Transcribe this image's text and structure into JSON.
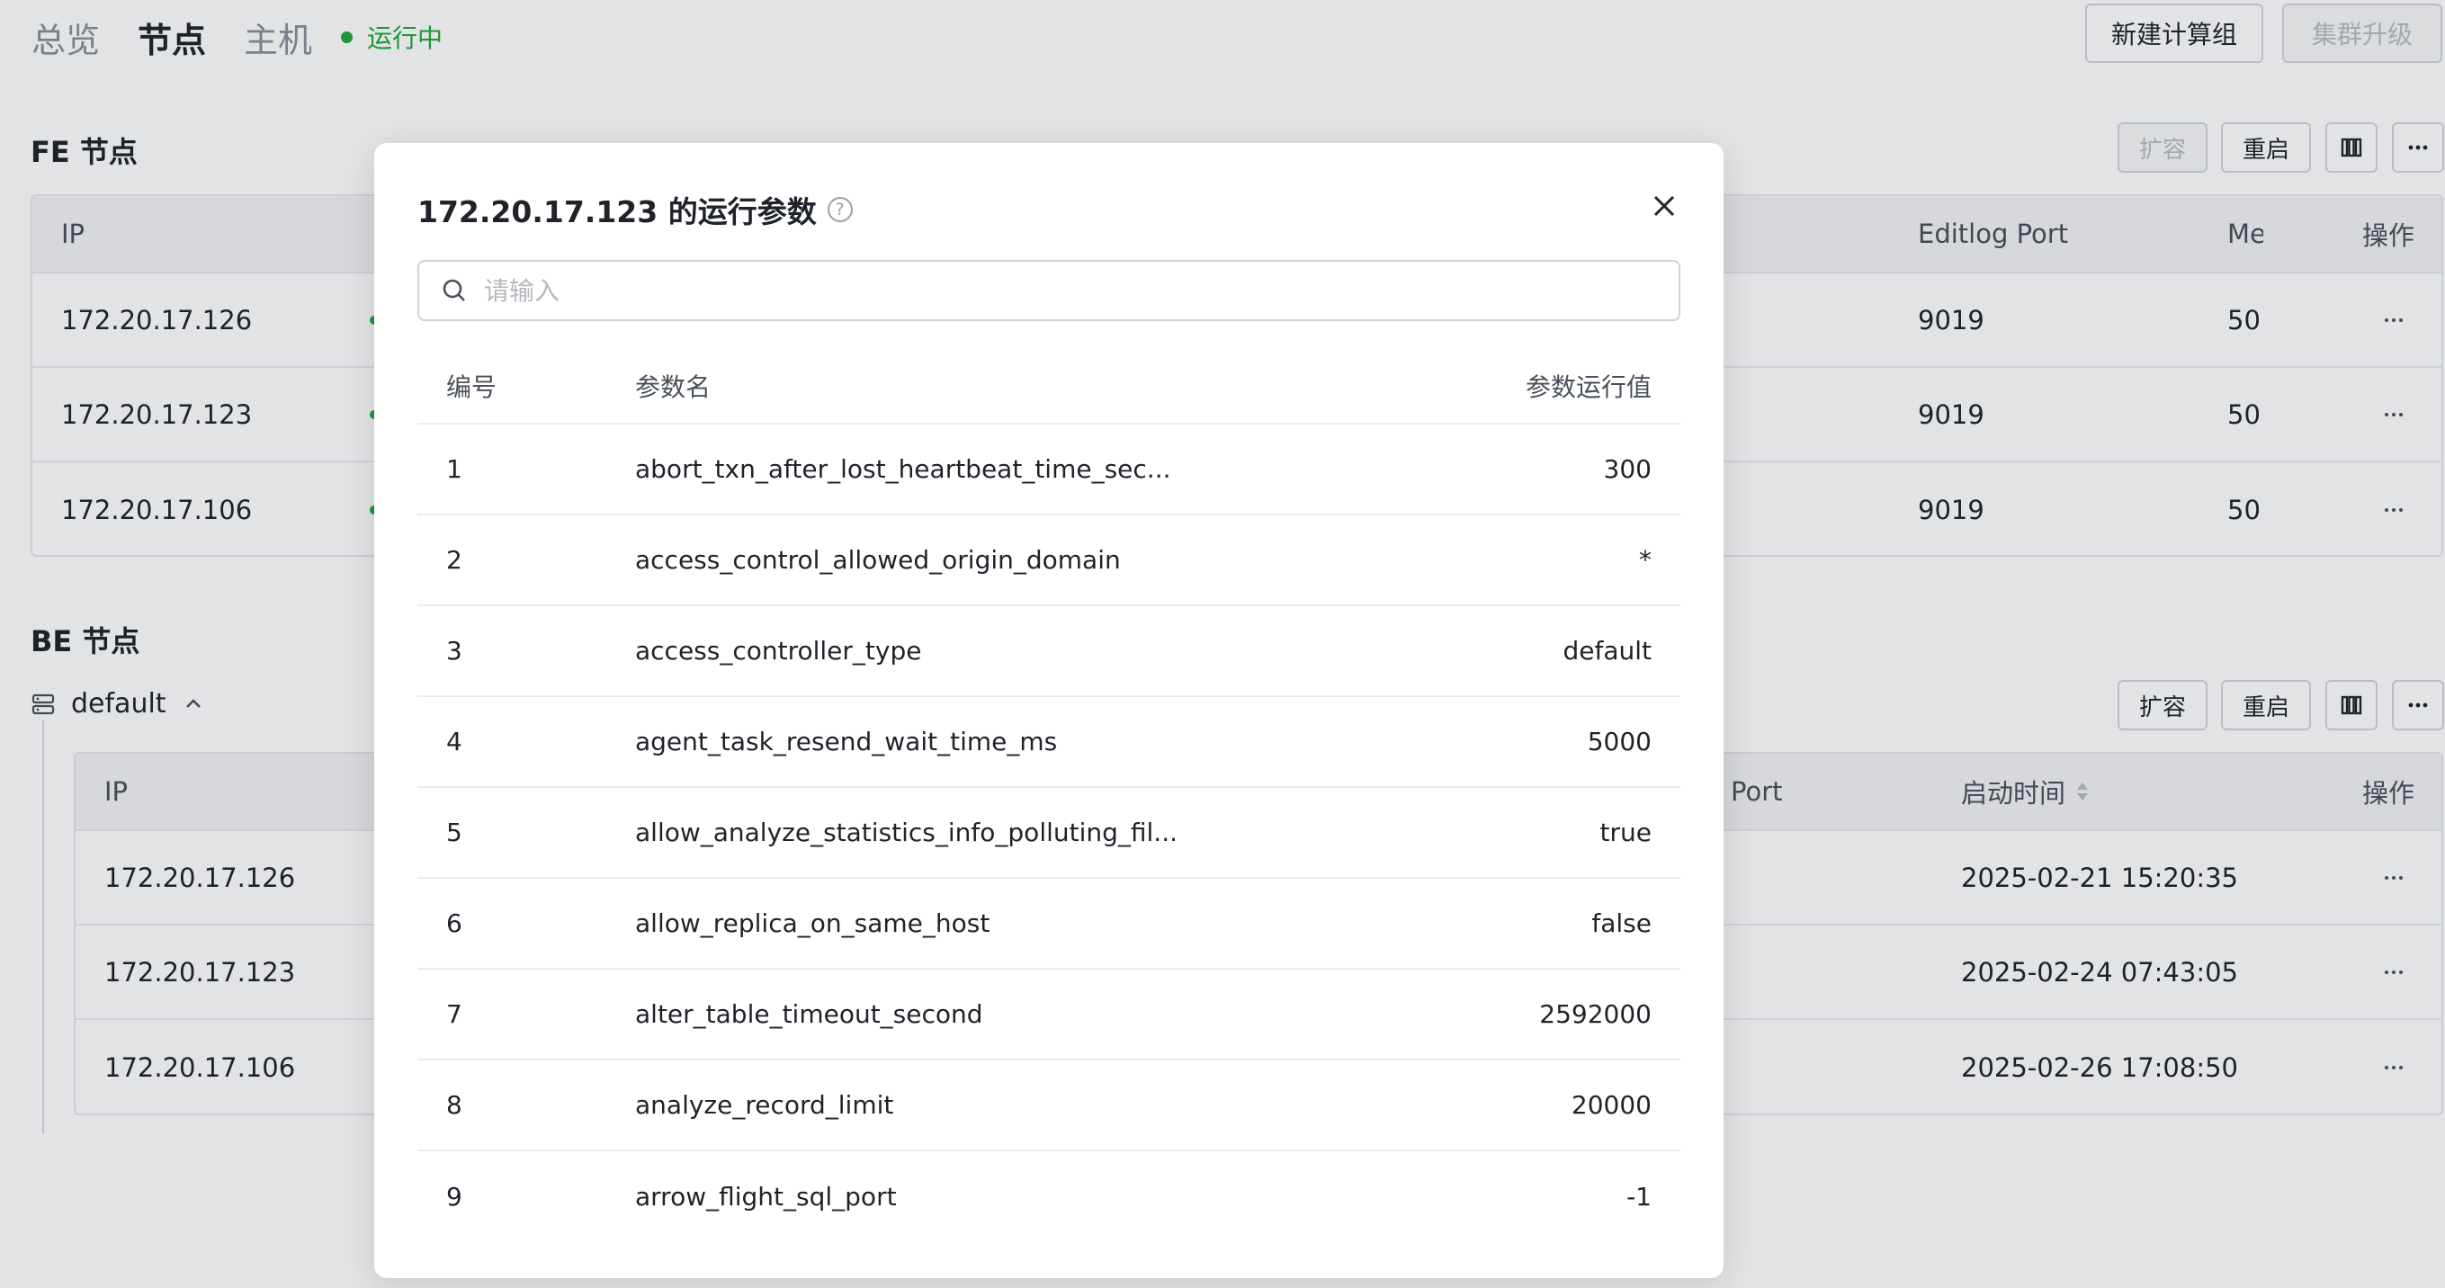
{
  "nav": {
    "tabs": [
      "总览",
      "节点",
      "主机"
    ],
    "active_tab": "节点",
    "status": "运行中"
  },
  "header_actions": {
    "new_compute_group": "新建计算组",
    "cluster_upgrade": "集群升级"
  },
  "fe": {
    "title": "FE 节点",
    "actions": {
      "scale": "扩容",
      "restart": "重启"
    },
    "columns": [
      "IP",
      "Editlog Port",
      "Me",
      "操作"
    ],
    "rows": [
      {
        "ip": "172.20.17.126",
        "editlog_port": "9019",
        "me": "50"
      },
      {
        "ip": "172.20.17.123",
        "editlog_port": "9019",
        "me": "50"
      },
      {
        "ip": "172.20.17.106",
        "editlog_port": "9019",
        "me": "50"
      }
    ]
  },
  "be": {
    "title": "BE 节点",
    "group": "default",
    "actions": {
      "scale": "扩容",
      "restart": "重启"
    },
    "columns": [
      "IP",
      "Port",
      "启动时间",
      "操作"
    ],
    "rows": [
      {
        "ip": "172.20.17.126",
        "start_time": "2025-02-21 15:20:35"
      },
      {
        "ip": "172.20.17.123",
        "start_time": "2025-02-24 07:43:05"
      },
      {
        "ip": "172.20.17.106",
        "start_time": "2025-02-26 17:08:50"
      }
    ]
  },
  "modal": {
    "title": "172.20.17.123 的运行参数",
    "search_placeholder": "请输入",
    "columns": {
      "num": "编号",
      "name": "参数名",
      "value": "参数运行值"
    },
    "rows": [
      {
        "num": "1",
        "name": "abort_txn_after_lost_heartbeat_time_sec...",
        "value": "300"
      },
      {
        "num": "2",
        "name": "access_control_allowed_origin_domain",
        "value": "*"
      },
      {
        "num": "3",
        "name": "access_controller_type",
        "value": "default"
      },
      {
        "num": "4",
        "name": "agent_task_resend_wait_time_ms",
        "value": "5000"
      },
      {
        "num": "5",
        "name": "allow_analyze_statistics_info_polluting_fil...",
        "value": "true"
      },
      {
        "num": "6",
        "name": "allow_replica_on_same_host",
        "value": "false"
      },
      {
        "num": "7",
        "name": "alter_table_timeout_second",
        "value": "2592000"
      },
      {
        "num": "8",
        "name": "analyze_record_limit",
        "value": "20000"
      },
      {
        "num": "9",
        "name": "arrow_flight_sql_port",
        "value": "-1"
      }
    ]
  },
  "icons": {
    "status": "status-dot-icon",
    "help": "help-circle-icon",
    "close": "close-icon",
    "search": "search-icon",
    "columns": "columns-icon",
    "more": "more-icon",
    "server": "server-icon",
    "chevron": "chevron-up-icon",
    "sort": "sort-icon"
  },
  "colors": {
    "status_green": "#20a83a",
    "primary_text": "#1f2329",
    "muted_text": "#8a9099",
    "border": "#d2d5da",
    "header_bg": "#f2f3f5"
  }
}
